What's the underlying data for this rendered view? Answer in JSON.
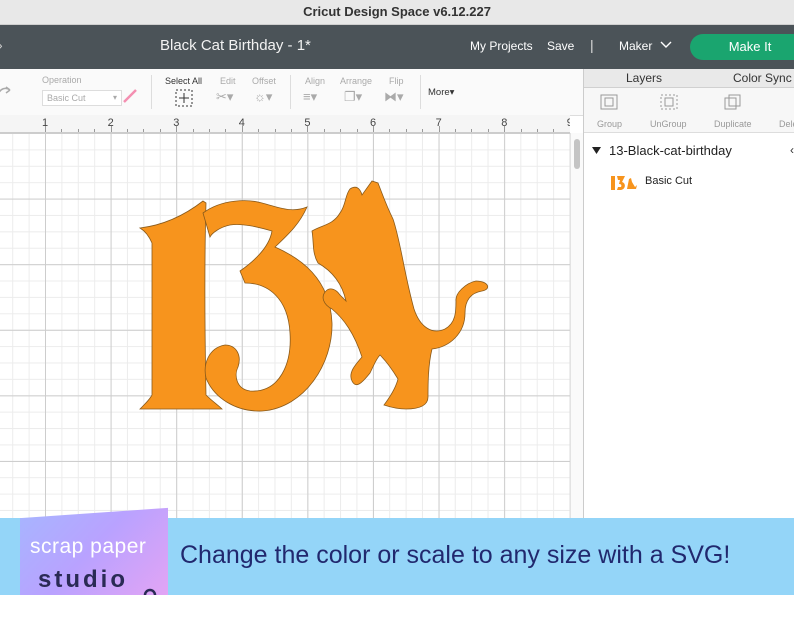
{
  "window": {
    "title": "Cricut Design Space  v6.12.227"
  },
  "header": {
    "doc_title": "Black Cat Birthday - 1*",
    "my_projects": "My Projects",
    "save": "Save",
    "separator": "|",
    "machine": "Maker",
    "make_it": "Make It"
  },
  "toolbar": {
    "operation_label": "Operation",
    "operation_value": "Basic Cut",
    "select_all": "Select All",
    "edit": "Edit",
    "offset": "Offset",
    "align": "Align",
    "arrange": "Arrange",
    "flip": "Flip",
    "more": "More"
  },
  "ruler": {
    "marks": [
      "1",
      "2",
      "3",
      "4",
      "5",
      "6",
      "7",
      "8",
      "9"
    ]
  },
  "panel": {
    "tabs": [
      "Layers",
      "Color Sync"
    ],
    "actions": [
      "Group",
      "UnGroup",
      "Duplicate",
      "Dele"
    ],
    "layer_group": "13-Black-cat-birthday",
    "layer_item": "Basic Cut"
  },
  "design": {
    "fill_color": "#f7941d",
    "outline_color": "#8a5a1a"
  },
  "banner": {
    "logo_line1": "scrap paper",
    "logo_line2": "studio",
    "text": "Change the color or scale to any size with a SVG!",
    "background": "#94d5f8",
    "text_color": "#21286e"
  }
}
